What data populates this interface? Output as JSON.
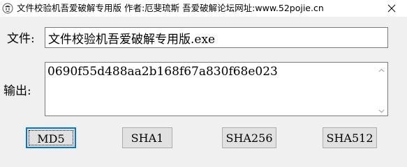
{
  "window": {
    "title": "文件校验机吾爱破解专用版 作者:厄斐琉斯 吾爱破解论坛网址:www.52pojie.cn",
    "icon": "app-logo-icon",
    "close_icon": "close-icon"
  },
  "form": {
    "file_label": "文件:",
    "file_value": "文件校验机吾爱破解专用版.exe",
    "output_label": "输出:",
    "output_value": "0690f55d488aa2b168f67a830f68e023"
  },
  "buttons": {
    "md5": "MD5",
    "sha1": "SHA1",
    "sha256": "SHA256",
    "sha512": "SHA512"
  },
  "colors": {
    "focus_border": "#0078d7",
    "button_bg": "#e1e1e1",
    "window_bg": "#f0f0f0"
  }
}
